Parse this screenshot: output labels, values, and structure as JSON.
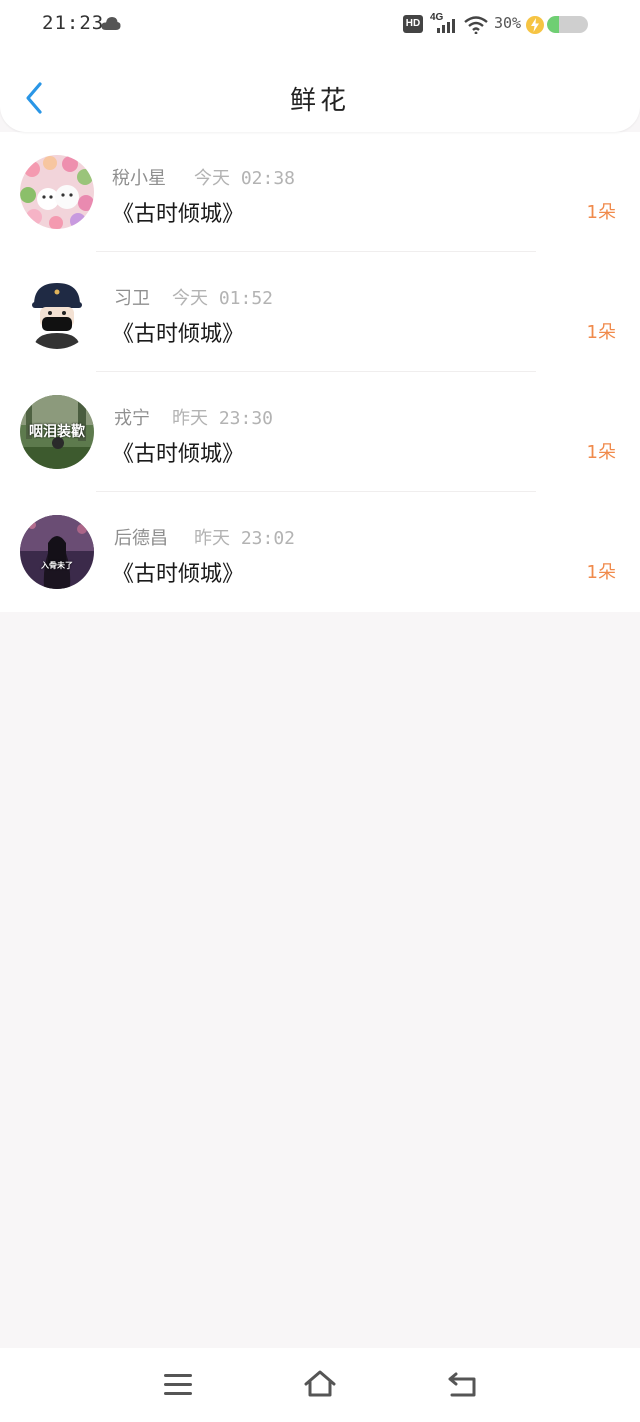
{
  "status_bar": {
    "time": "21:23",
    "hd": "HD",
    "network": "4G",
    "battery": "30%",
    "battery_level": 0.3
  },
  "header": {
    "title": "鲜花"
  },
  "records": [
    {
      "name": "稅小星",
      "time": "今天 02:38",
      "book": "《古时倾城》",
      "count": "1朵"
    },
    {
      "name": "习卫",
      "time": "今天 01:52",
      "book": "《古时倾城》",
      "count": "1朵"
    },
    {
      "name": "戎宁",
      "time": "昨天 23:30",
      "book": "《古时倾城》",
      "count": "1朵",
      "avatar_text": "咽泪装歡"
    },
    {
      "name": "后德昌",
      "time": "昨天 23:02",
      "book": "《古时倾城》",
      "count": "1朵",
      "avatar_text": "入骨未了"
    }
  ],
  "colors": {
    "accent": "#2a96e6",
    "count": "#f08a4b",
    "background": "#f8f6f7"
  }
}
